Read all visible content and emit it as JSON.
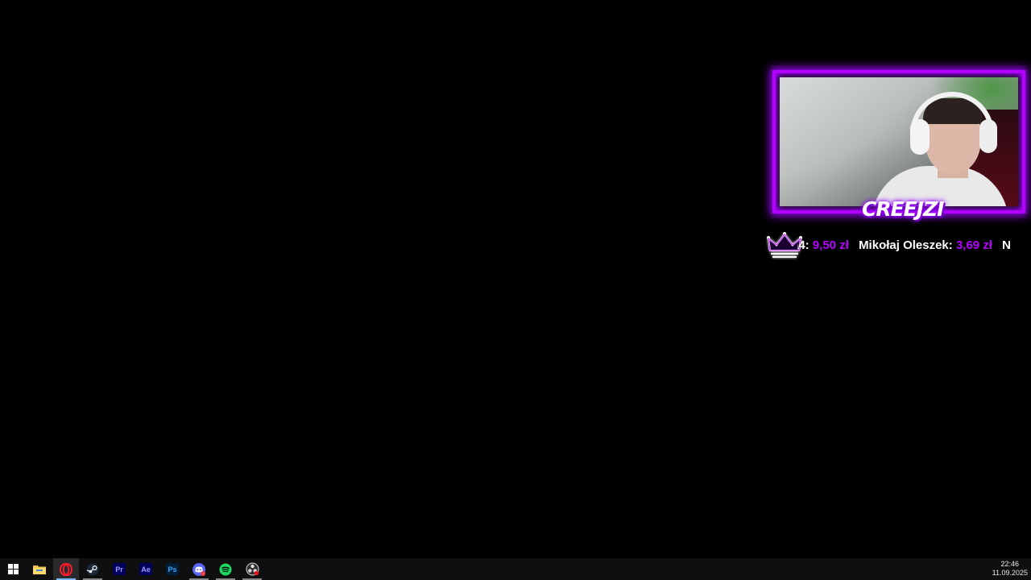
{
  "overlay": {
    "streamer_name": "CREEJZI",
    "colors": {
      "accent": "#b400ff",
      "amount": "#b600ff"
    }
  },
  "ticker": {
    "icon": "crown-icon",
    "entries": [
      {
        "name": "a4:",
        "amount": "9,50 zł"
      },
      {
        "name": "Mikołaj Oleszek:",
        "amount": "3,69 zł"
      },
      {
        "name": "N",
        "amount": ""
      }
    ]
  },
  "taskbar": {
    "items": [
      {
        "name": "start-button",
        "icon": "windows-icon"
      },
      {
        "name": "file-explorer",
        "icon": "folder-icon"
      },
      {
        "name": "opera",
        "icon": "opera-icon"
      },
      {
        "name": "steam",
        "icon": "steam-icon"
      },
      {
        "name": "premiere",
        "icon": "premiere-icon",
        "label": "Pr"
      },
      {
        "name": "after-effects",
        "icon": "after-effects-icon",
        "label": "Ae"
      },
      {
        "name": "photoshop",
        "icon": "photoshop-icon",
        "label": "Ps"
      },
      {
        "name": "discord",
        "icon": "discord-icon"
      },
      {
        "name": "spotify",
        "icon": "spotify-icon"
      },
      {
        "name": "obs",
        "icon": "obs-icon"
      }
    ],
    "clock": {
      "time": "22:46",
      "date": "11.09.2025"
    }
  }
}
